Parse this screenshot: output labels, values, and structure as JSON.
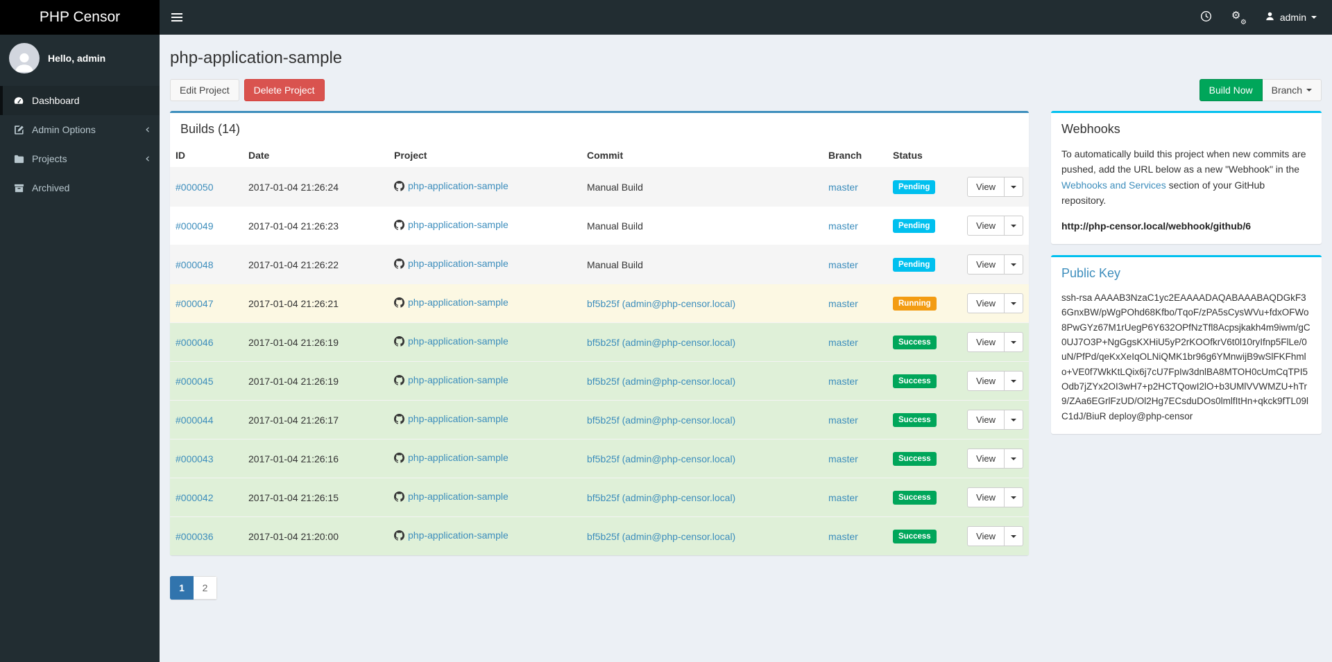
{
  "colors": {
    "accent_blue": "#3c8dbc",
    "accent_cyan": "#00c0ef",
    "success_green": "#00a65a",
    "warning_orange": "#f39c12",
    "danger_red": "#d9534f",
    "navbar_bg": "#222d32",
    "logo_bg": "#000000",
    "body_bg": "#ecf0f5"
  },
  "icons": {
    "bars": "menu glyph (3 bars)",
    "clock": "clock-icon",
    "gears": "⚙",
    "user": "person silhouette",
    "caret_down": "triangle-down",
    "chevron_left": "‹",
    "github": "octocat mark"
  },
  "navbar": {
    "brand": "PHP Censor",
    "user_label": "admin"
  },
  "sidebar": {
    "greeting": "Hello, admin",
    "items": [
      {
        "label": "Dashboard",
        "icon": "tachometer-icon",
        "active": true
      },
      {
        "label": "Admin Options",
        "icon": "edit-icon",
        "has_submenu": true
      },
      {
        "label": "Projects",
        "icon": "folder-icon",
        "has_submenu": true
      },
      {
        "label": "Archived",
        "icon": "archive-icon"
      }
    ]
  },
  "page": {
    "title": "php-application-sample",
    "edit_button": "Edit Project",
    "delete_button": "Delete Project",
    "build_button": "Build Now",
    "branch_button": "Branch"
  },
  "builds": {
    "title": "Builds (14)",
    "headers": [
      "ID",
      "Date",
      "Project",
      "Commit",
      "Branch",
      "Status"
    ],
    "view_label": "View",
    "rows": [
      {
        "id": "#000050",
        "date": "2017-01-04 21:26:24",
        "project": "php-application-sample",
        "commit": "Manual Build",
        "commit_is_link": false,
        "branch": "master",
        "status": "Pending",
        "state": "pending",
        "striped": true
      },
      {
        "id": "#000049",
        "date": "2017-01-04 21:26:23",
        "project": "php-application-sample",
        "commit": "Manual Build",
        "commit_is_link": false,
        "branch": "master",
        "status": "Pending",
        "state": "pending",
        "striped": false
      },
      {
        "id": "#000048",
        "date": "2017-01-04 21:26:22",
        "project": "php-application-sample",
        "commit": "Manual Build",
        "commit_is_link": false,
        "branch": "master",
        "status": "Pending",
        "state": "pending",
        "striped": true
      },
      {
        "id": "#000047",
        "date": "2017-01-04 21:26:21",
        "project": "php-application-sample",
        "commit": "bf5b25f (admin@php-censor.local)",
        "commit_is_link": true,
        "branch": "master",
        "status": "Running",
        "state": "running",
        "striped": false
      },
      {
        "id": "#000046",
        "date": "2017-01-04 21:26:19",
        "project": "php-application-sample",
        "commit": "bf5b25f (admin@php-censor.local)",
        "commit_is_link": true,
        "branch": "master",
        "status": "Success",
        "state": "success",
        "striped": true
      },
      {
        "id": "#000045",
        "date": "2017-01-04 21:26:19",
        "project": "php-application-sample",
        "commit": "bf5b25f (admin@php-censor.local)",
        "commit_is_link": true,
        "branch": "master",
        "status": "Success",
        "state": "success",
        "striped": false
      },
      {
        "id": "#000044",
        "date": "2017-01-04 21:26:17",
        "project": "php-application-sample",
        "commit": "bf5b25f (admin@php-censor.local)",
        "commit_is_link": true,
        "branch": "master",
        "status": "Success",
        "state": "success",
        "striped": true
      },
      {
        "id": "#000043",
        "date": "2017-01-04 21:26:16",
        "project": "php-application-sample",
        "commit": "bf5b25f (admin@php-censor.local)",
        "commit_is_link": true,
        "branch": "master",
        "status": "Success",
        "state": "success",
        "striped": false
      },
      {
        "id": "#000042",
        "date": "2017-01-04 21:26:15",
        "project": "php-application-sample",
        "commit": "bf5b25f (admin@php-censor.local)",
        "commit_is_link": true,
        "branch": "master",
        "status": "Success",
        "state": "success",
        "striped": true
      },
      {
        "id": "#000036",
        "date": "2017-01-04 21:20:00",
        "project": "php-application-sample",
        "commit": "bf5b25f (admin@php-censor.local)",
        "commit_is_link": true,
        "branch": "master",
        "status": "Success",
        "state": "success",
        "striped": false
      }
    ]
  },
  "pagination": {
    "pages": [
      "1",
      "2"
    ],
    "active_page": "1"
  },
  "webhooks": {
    "title": "Webhooks",
    "text_before": "To automatically build this project when new commits are pushed, add the URL below as a new \"Webhook\" in the ",
    "link_text": "Webhooks and Services",
    "text_after": " section of your GitHub repository.",
    "url": "http://php-censor.local/webhook/github/6"
  },
  "public_key": {
    "title": "Public Key",
    "key": "ssh-rsa AAAAB3NzaC1yc2EAAAADAQABAAABAQDGkF36GnxBW/pWgPOhd68Kfbo/TqoF/zPA5sCysWVu+fdxOFWo8PwGYz67M1rUegP6Y632OPfNzTfl8Acpsjkakh4m9iwm/gC0UJ7O3P+NgGgsKXHiU5yP2rKOOfkrV6t0l10ryIfnp5FlLe/0uN/PfPd/qeKxXeIqOLNiQMK1br96g6YMnwijB9wSlFKFhmlo+VE0f7WkKtLQix6j7cU7FpIw3dnlBA8MTOH0cUmCqTPI5Odb7jZYx2OI3wH7+p2HCTQowI2lO+b3UMlVVWMZU+hTr9/ZAa6EGrlFzUD/Ol2Hg7ECsduDOs0lmlfItHn+qkck9fTL09lC1dJ/BiuR deploy@php-censor"
  }
}
